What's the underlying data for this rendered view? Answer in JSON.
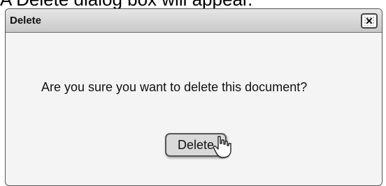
{
  "caption": {
    "text": "A Delete dialog box will appear."
  },
  "dialog": {
    "title": "Delete",
    "close_icon": "close-icon",
    "message": "Are you sure you want to delete this document?",
    "delete_button_label": "Delete"
  },
  "cursor": {
    "icon": "pointer-hand-icon"
  }
}
